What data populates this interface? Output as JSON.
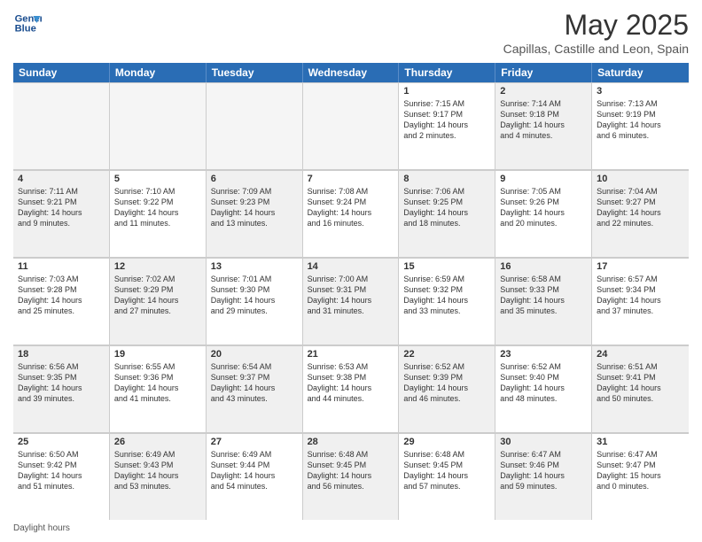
{
  "header": {
    "logo_line1": "General",
    "logo_line2": "Blue",
    "title": "May 2025",
    "subtitle": "Capillas, Castille and Leon, Spain"
  },
  "days_of_week": [
    "Sunday",
    "Monday",
    "Tuesday",
    "Wednesday",
    "Thursday",
    "Friday",
    "Saturday"
  ],
  "rows": [
    [
      {
        "day": "",
        "text": "",
        "empty": true
      },
      {
        "day": "",
        "text": "",
        "empty": true
      },
      {
        "day": "",
        "text": "",
        "empty": true
      },
      {
        "day": "",
        "text": "",
        "empty": true
      },
      {
        "day": "1",
        "text": "Sunrise: 7:15 AM\nSunset: 9:17 PM\nDaylight: 14 hours\nand 2 minutes.",
        "shaded": false
      },
      {
        "day": "2",
        "text": "Sunrise: 7:14 AM\nSunset: 9:18 PM\nDaylight: 14 hours\nand 4 minutes.",
        "shaded": true
      },
      {
        "day": "3",
        "text": "Sunrise: 7:13 AM\nSunset: 9:19 PM\nDaylight: 14 hours\nand 6 minutes.",
        "shaded": false
      }
    ],
    [
      {
        "day": "4",
        "text": "Sunrise: 7:11 AM\nSunset: 9:21 PM\nDaylight: 14 hours\nand 9 minutes.",
        "shaded": true
      },
      {
        "day": "5",
        "text": "Sunrise: 7:10 AM\nSunset: 9:22 PM\nDaylight: 14 hours\nand 11 minutes.",
        "shaded": false
      },
      {
        "day": "6",
        "text": "Sunrise: 7:09 AM\nSunset: 9:23 PM\nDaylight: 14 hours\nand 13 minutes.",
        "shaded": true
      },
      {
        "day": "7",
        "text": "Sunrise: 7:08 AM\nSunset: 9:24 PM\nDaylight: 14 hours\nand 16 minutes.",
        "shaded": false
      },
      {
        "day": "8",
        "text": "Sunrise: 7:06 AM\nSunset: 9:25 PM\nDaylight: 14 hours\nand 18 minutes.",
        "shaded": true
      },
      {
        "day": "9",
        "text": "Sunrise: 7:05 AM\nSunset: 9:26 PM\nDaylight: 14 hours\nand 20 minutes.",
        "shaded": false
      },
      {
        "day": "10",
        "text": "Sunrise: 7:04 AM\nSunset: 9:27 PM\nDaylight: 14 hours\nand 22 minutes.",
        "shaded": true
      }
    ],
    [
      {
        "day": "11",
        "text": "Sunrise: 7:03 AM\nSunset: 9:28 PM\nDaylight: 14 hours\nand 25 minutes.",
        "shaded": false
      },
      {
        "day": "12",
        "text": "Sunrise: 7:02 AM\nSunset: 9:29 PM\nDaylight: 14 hours\nand 27 minutes.",
        "shaded": true
      },
      {
        "day": "13",
        "text": "Sunrise: 7:01 AM\nSunset: 9:30 PM\nDaylight: 14 hours\nand 29 minutes.",
        "shaded": false
      },
      {
        "day": "14",
        "text": "Sunrise: 7:00 AM\nSunset: 9:31 PM\nDaylight: 14 hours\nand 31 minutes.",
        "shaded": true
      },
      {
        "day": "15",
        "text": "Sunrise: 6:59 AM\nSunset: 9:32 PM\nDaylight: 14 hours\nand 33 minutes.",
        "shaded": false
      },
      {
        "day": "16",
        "text": "Sunrise: 6:58 AM\nSunset: 9:33 PM\nDaylight: 14 hours\nand 35 minutes.",
        "shaded": true
      },
      {
        "day": "17",
        "text": "Sunrise: 6:57 AM\nSunset: 9:34 PM\nDaylight: 14 hours\nand 37 minutes.",
        "shaded": false
      }
    ],
    [
      {
        "day": "18",
        "text": "Sunrise: 6:56 AM\nSunset: 9:35 PM\nDaylight: 14 hours\nand 39 minutes.",
        "shaded": true
      },
      {
        "day": "19",
        "text": "Sunrise: 6:55 AM\nSunset: 9:36 PM\nDaylight: 14 hours\nand 41 minutes.",
        "shaded": false
      },
      {
        "day": "20",
        "text": "Sunrise: 6:54 AM\nSunset: 9:37 PM\nDaylight: 14 hours\nand 43 minutes.",
        "shaded": true
      },
      {
        "day": "21",
        "text": "Sunrise: 6:53 AM\nSunset: 9:38 PM\nDaylight: 14 hours\nand 44 minutes.",
        "shaded": false
      },
      {
        "day": "22",
        "text": "Sunrise: 6:52 AM\nSunset: 9:39 PM\nDaylight: 14 hours\nand 46 minutes.",
        "shaded": true
      },
      {
        "day": "23",
        "text": "Sunrise: 6:52 AM\nSunset: 9:40 PM\nDaylight: 14 hours\nand 48 minutes.",
        "shaded": false
      },
      {
        "day": "24",
        "text": "Sunrise: 6:51 AM\nSunset: 9:41 PM\nDaylight: 14 hours\nand 50 minutes.",
        "shaded": true
      }
    ],
    [
      {
        "day": "25",
        "text": "Sunrise: 6:50 AM\nSunset: 9:42 PM\nDaylight: 14 hours\nand 51 minutes.",
        "shaded": false
      },
      {
        "day": "26",
        "text": "Sunrise: 6:49 AM\nSunset: 9:43 PM\nDaylight: 14 hours\nand 53 minutes.",
        "shaded": true
      },
      {
        "day": "27",
        "text": "Sunrise: 6:49 AM\nSunset: 9:44 PM\nDaylight: 14 hours\nand 54 minutes.",
        "shaded": false
      },
      {
        "day": "28",
        "text": "Sunrise: 6:48 AM\nSunset: 9:45 PM\nDaylight: 14 hours\nand 56 minutes.",
        "shaded": true
      },
      {
        "day": "29",
        "text": "Sunrise: 6:48 AM\nSunset: 9:45 PM\nDaylight: 14 hours\nand 57 minutes.",
        "shaded": false
      },
      {
        "day": "30",
        "text": "Sunrise: 6:47 AM\nSunset: 9:46 PM\nDaylight: 14 hours\nand 59 minutes.",
        "shaded": true
      },
      {
        "day": "31",
        "text": "Sunrise: 6:47 AM\nSunset: 9:47 PM\nDaylight: 15 hours\nand 0 minutes.",
        "shaded": false
      }
    ]
  ],
  "footer": "Daylight hours"
}
